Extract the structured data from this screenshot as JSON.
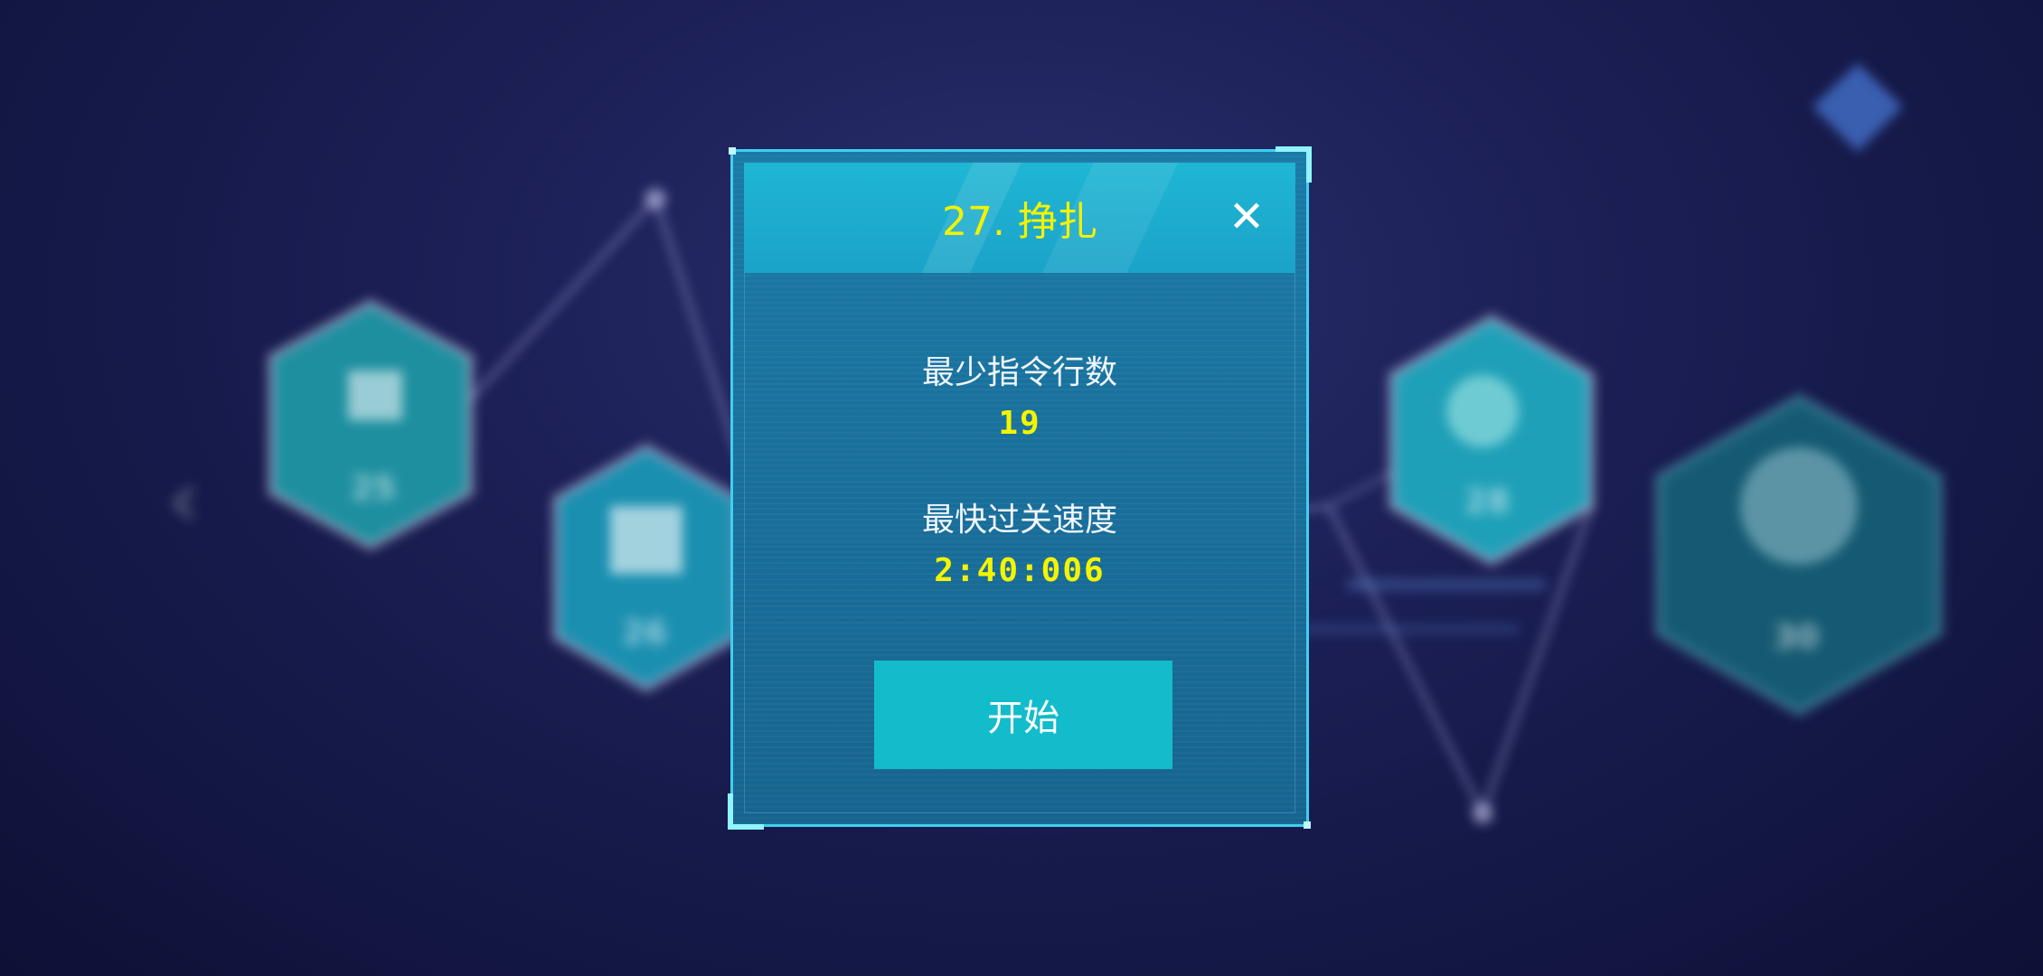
{
  "level_dialog": {
    "title": "27. 挣扎",
    "close_symbol": "✕",
    "min_lines_label": "最少指令行数",
    "min_lines_value": "19",
    "fastest_label": "最快过关速度",
    "fastest_value": "2:40:006",
    "start_label": "开始"
  },
  "background_levels": [
    "25",
    "26",
    "28",
    "30"
  ],
  "colors": {
    "accent_yellow": "#f2f200",
    "button_teal": "#12bccb",
    "dialog_border": "#3fd0f0"
  }
}
